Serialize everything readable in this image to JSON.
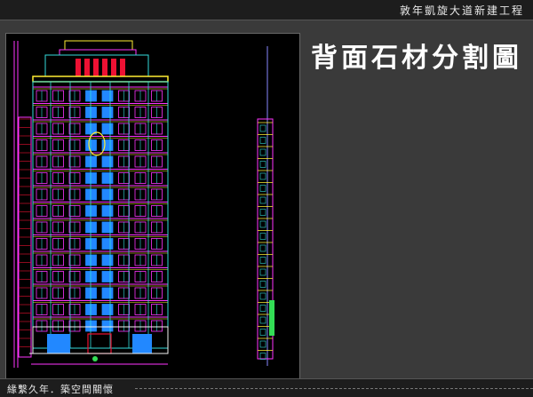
{
  "header": {
    "project_title": "敦年凱旋大道新建工程"
  },
  "slide": {
    "heading": "背面石材分割圖"
  },
  "footer": {
    "tagline": "緣繫久年．築空間關懷"
  },
  "drawing": {
    "description_icon": "cad-elevation-drawing",
    "colors": {
      "background": "#000000",
      "magenta": "#ff33ff",
      "blue": "#2288ff",
      "cyan": "#33dddd",
      "yellow": "#ffee33",
      "red": "#ee1133",
      "white": "#f2f2f2",
      "green": "#33dd55"
    }
  }
}
